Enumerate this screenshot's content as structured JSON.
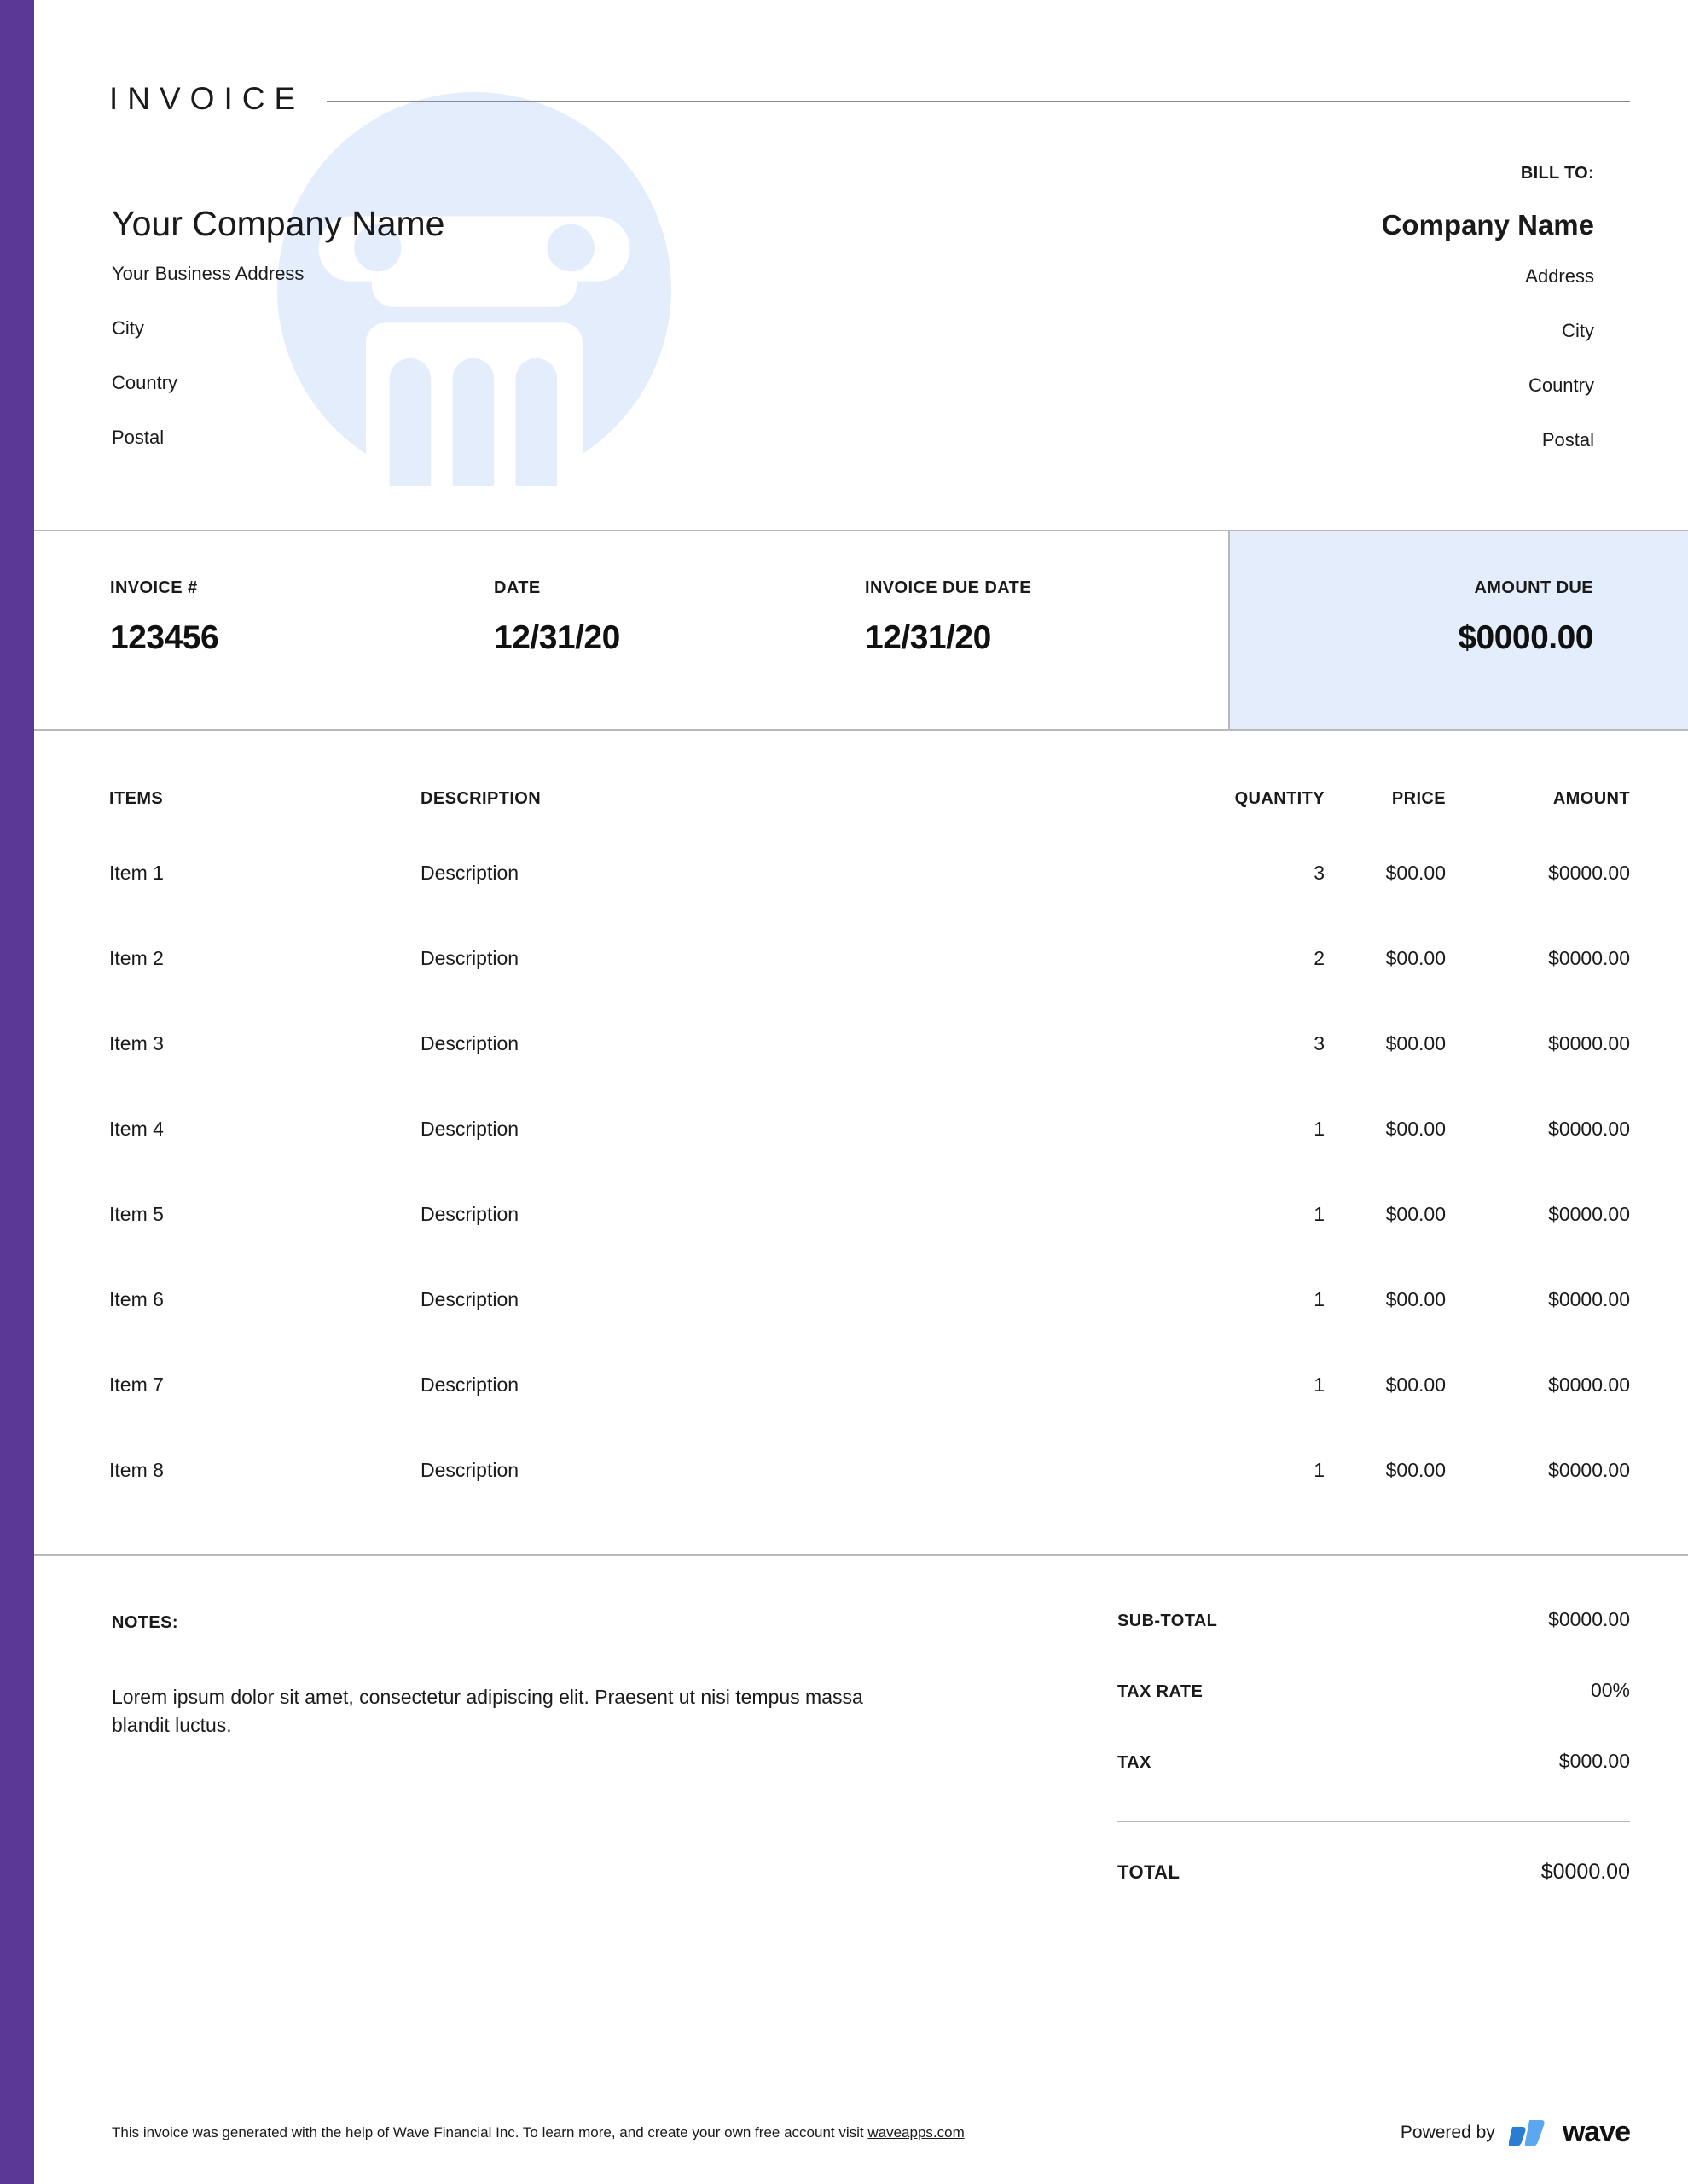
{
  "document": {
    "title": "I N V O I C E",
    "title_plain": "INVOICE"
  },
  "colors": {
    "accent_purple": "#5C3896",
    "amount_due_bg": "#E4EDFB",
    "watermark_blue": "#E3EDFB",
    "rule_gray": "#b9b9b9",
    "wave_blue_dark": "#2B7CD3",
    "wave_blue_light": "#5BA8F0"
  },
  "seller": {
    "company_name": "Your Company Name",
    "address_lines": [
      "Your Business Address",
      "City",
      "Country",
      "Postal"
    ]
  },
  "bill_to": {
    "label": "BILL TO:",
    "company_name": "Company Name",
    "address_lines": [
      "Address",
      "City",
      "Country",
      "Postal"
    ]
  },
  "invoice_info": {
    "invoice_number_label": "INVOICE #",
    "invoice_number_value": "123456",
    "date_label": "DATE",
    "date_value": "12/31/20",
    "due_date_label": "INVOICE DUE DATE",
    "due_date_value": "12/31/20",
    "amount_due_label": "AMOUNT DUE",
    "amount_due_value": "$0000.00"
  },
  "items_table": {
    "headers": {
      "items": "ITEMS",
      "description": "DESCRIPTION",
      "quantity": "QUANTITY",
      "price": "PRICE",
      "amount": "AMOUNT"
    },
    "rows": [
      {
        "item": "Item 1",
        "description": "Description",
        "quantity": "3",
        "price": "$00.00",
        "amount": "$0000.00"
      },
      {
        "item": "Item 2",
        "description": "Description",
        "quantity": "2",
        "price": "$00.00",
        "amount": "$0000.00"
      },
      {
        "item": "Item 3",
        "description": "Description",
        "quantity": "3",
        "price": "$00.00",
        "amount": "$0000.00"
      },
      {
        "item": "Item 4",
        "description": "Description",
        "quantity": "1",
        "price": "$00.00",
        "amount": "$0000.00"
      },
      {
        "item": "Item 5",
        "description": "Description",
        "quantity": "1",
        "price": "$00.00",
        "amount": "$0000.00"
      },
      {
        "item": "Item 6",
        "description": "Description",
        "quantity": "1",
        "price": "$00.00",
        "amount": "$0000.00"
      },
      {
        "item": "Item 7",
        "description": "Description",
        "quantity": "1",
        "price": "$00.00",
        "amount": "$0000.00"
      },
      {
        "item": "Item 8",
        "description": "Description",
        "quantity": "1",
        "price": "$00.00",
        "amount": "$0000.00"
      }
    ]
  },
  "notes": {
    "label": "NOTES:",
    "text": "Lorem ipsum dolor sit amet, consectetur adipiscing elit. Praesent ut nisi tempus massa blandit luctus."
  },
  "totals": {
    "subtotal_label": "SUB-TOTAL",
    "subtotal_value": "$0000.00",
    "tax_rate_label": "TAX RATE",
    "tax_rate_value": "00%",
    "tax_label": "TAX",
    "tax_value": "$000.00",
    "total_label": "TOTAL",
    "total_value": "$0000.00"
  },
  "footer": {
    "disclaimer_before": "This invoice was generated with the help of Wave Financial Inc. To learn more, and create your own free account visit ",
    "link_text": "waveapps.com",
    "powered_by_label": "Powered by",
    "brand_name": "wave"
  }
}
